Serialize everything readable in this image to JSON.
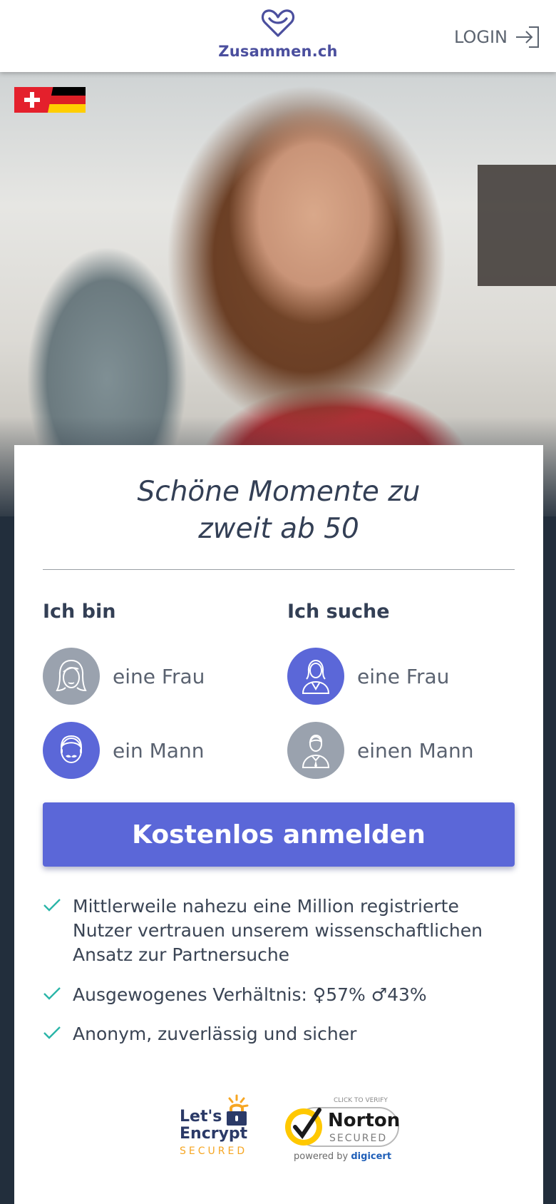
{
  "header": {
    "brand": "Zusammen.ch",
    "login_label": "LOGIN",
    "brand_color": "#4b4f9e",
    "logo_icon": "heart-infinity-icon",
    "login_icon": "login-arrow-icon"
  },
  "hero": {
    "languages": [
      "ch-flag",
      "de-flag"
    ]
  },
  "card": {
    "headline_line1": "Schöne Momente zu",
    "headline_line2": "zweit ab 50",
    "i_am": {
      "title": "Ich bin",
      "options": [
        {
          "label": "eine Frau",
          "icon": "woman-face-icon",
          "selected": false
        },
        {
          "label": "ein Mann",
          "icon": "man-face-icon",
          "selected": true
        }
      ]
    },
    "looking_for": {
      "title": "Ich suche",
      "options": [
        {
          "label": "eine Frau",
          "icon": "woman-bust-icon",
          "selected": true
        },
        {
          "label": "einen Mann",
          "icon": "man-bust-icon",
          "selected": false
        }
      ]
    },
    "cta_label": "Kostenlos anmelden",
    "accent_color": "#5b67d8",
    "check_color": "#2ab5a8",
    "benefits": [
      "Mittlerweile nahezu eine Million registrierte Nutzer vertrauen unserem wissenschaftlichen Ansatz zur Partnersuche",
      "Ausgewogenes Verhältnis: ♀57% ♂43%",
      "Anonym, zuverlässig und sicher"
    ],
    "badges": {
      "letsencrypt_line1": "Let's",
      "letsencrypt_line2": "Encrypt",
      "letsencrypt_line3": "SECURED",
      "norton_top": "CLICK TO VERIFY",
      "norton_name": "Norton",
      "norton_secured": "SECURED",
      "norton_powered": "powered by",
      "norton_brand": "digicert"
    }
  }
}
